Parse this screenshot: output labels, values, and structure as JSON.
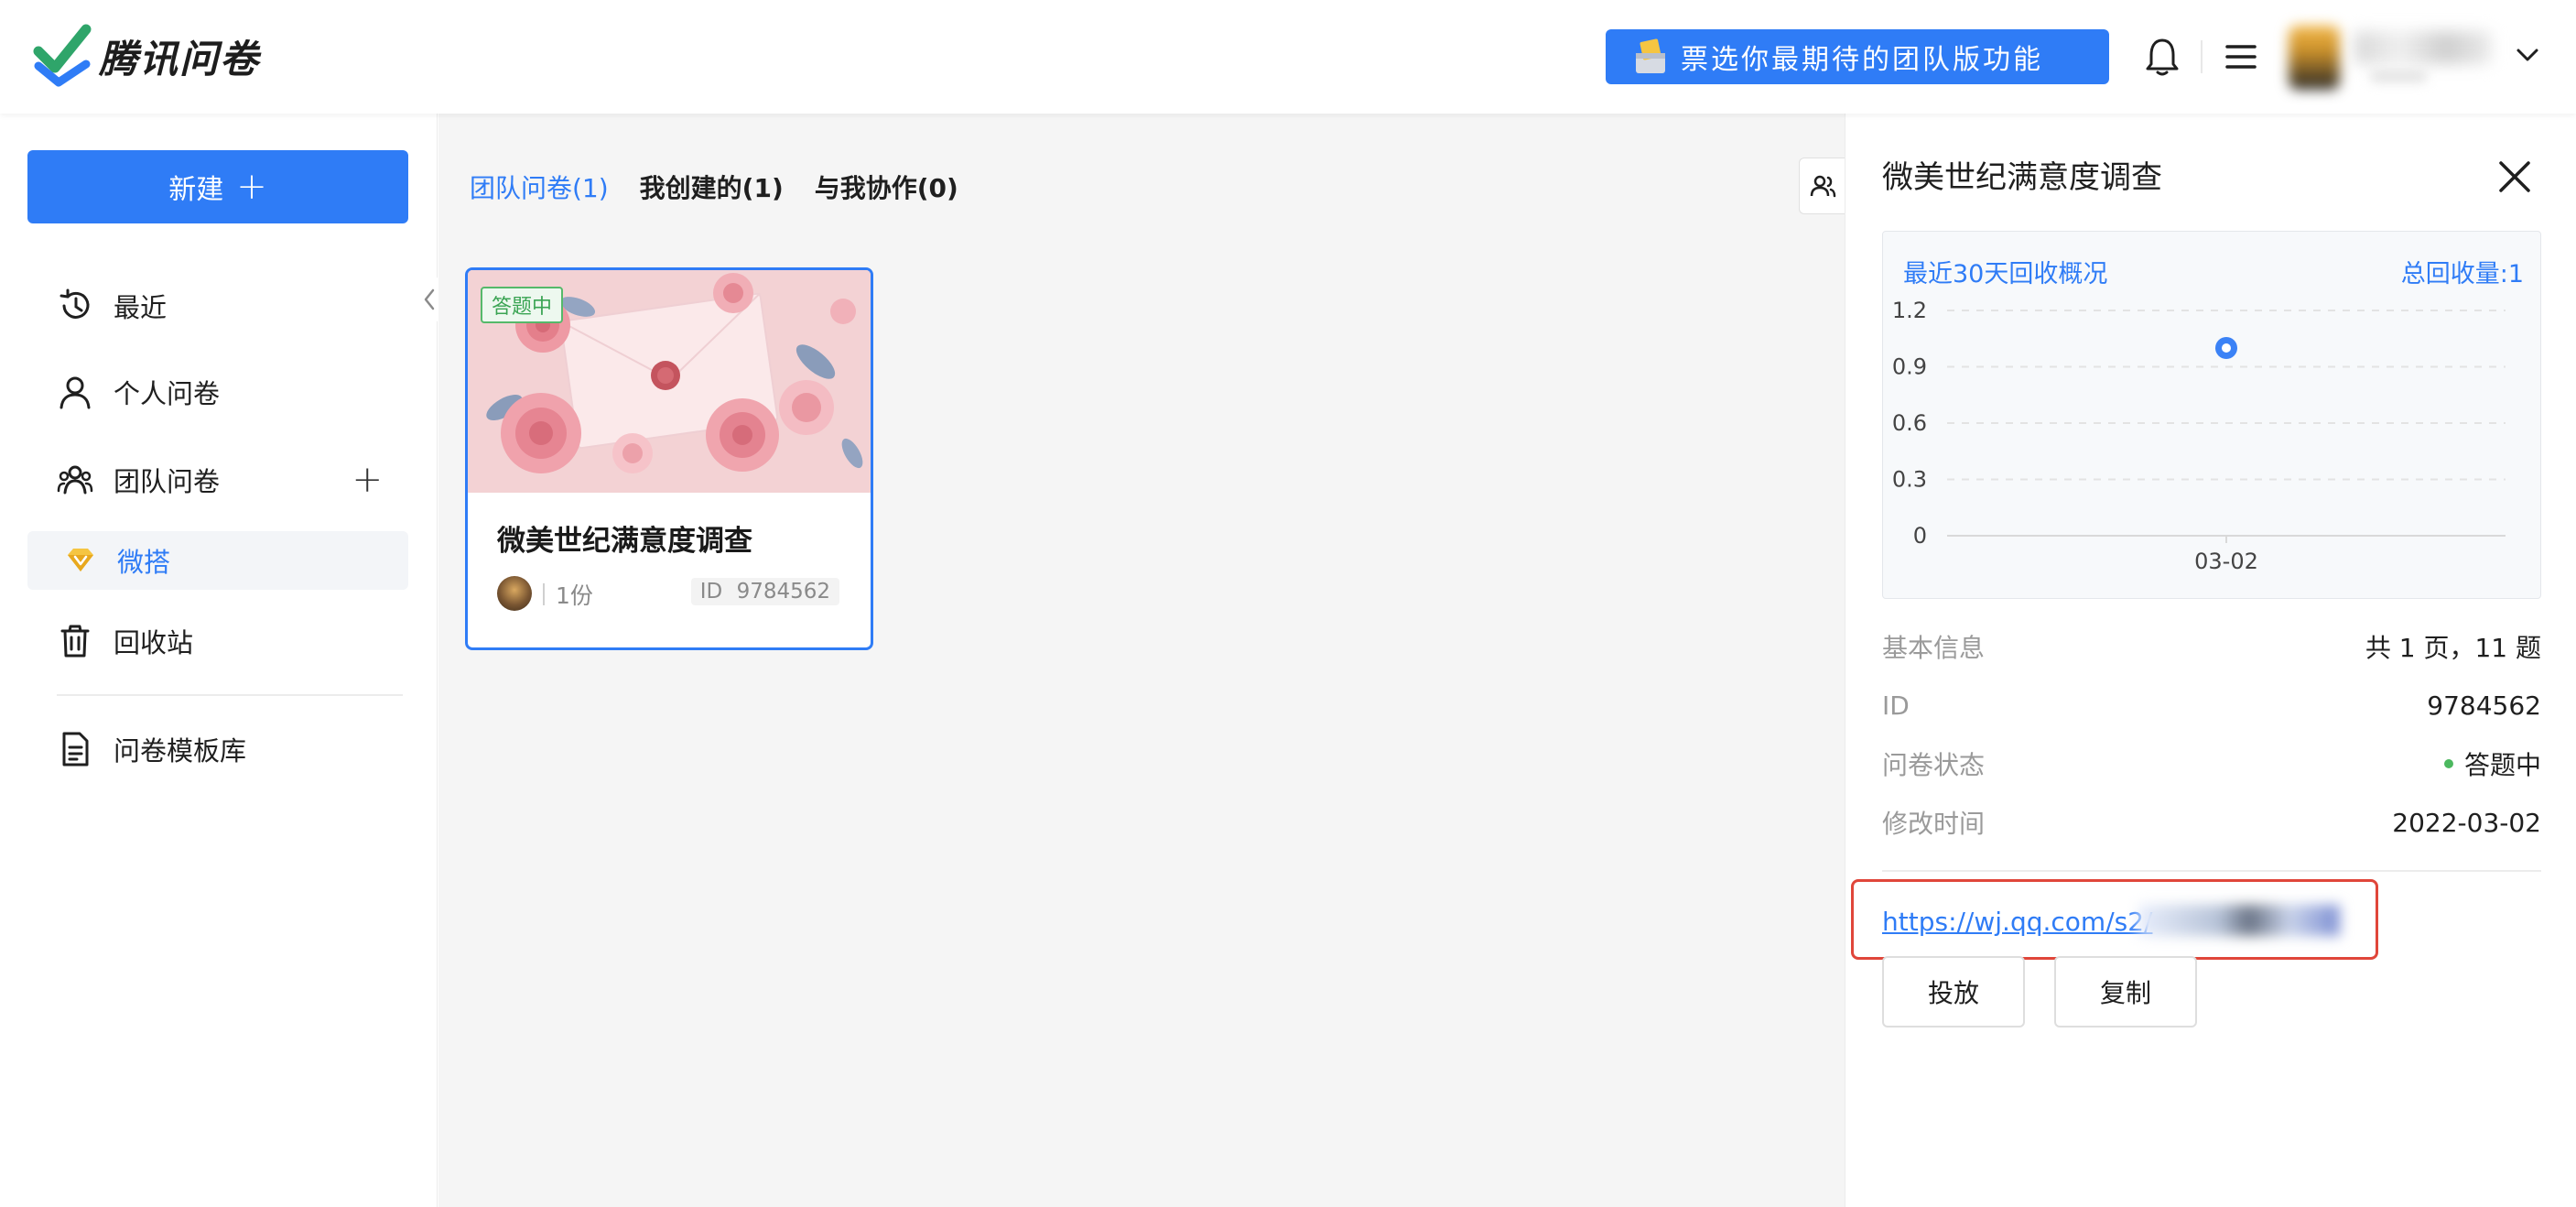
{
  "app": {
    "logo_text": "腾讯问卷",
    "promo_label": "票选你最期待的团队版功能"
  },
  "sidebar": {
    "new_label": "新建",
    "items": [
      {
        "label": "最近",
        "icon": "history-icon"
      },
      {
        "label": "个人问卷",
        "icon": "user-icon"
      },
      {
        "label": "团队问卷",
        "icon": "team-icon"
      },
      {
        "label": "微搭",
        "icon": "gem-icon"
      },
      {
        "label": "回收站",
        "icon": "trash-icon"
      },
      {
        "label": "问卷模板库",
        "icon": "template-icon"
      }
    ]
  },
  "main": {
    "tabs": [
      {
        "label": "团队问卷(1)",
        "active": true
      },
      {
        "label": "我创建的(1)",
        "active": false
      },
      {
        "label": "与我协作(0)",
        "active": false
      }
    ],
    "card": {
      "status": "答题中",
      "title": "微美世纪满意度调查",
      "count": "1份",
      "id_label": "ID",
      "id_value": "9784562"
    }
  },
  "panel": {
    "title": "微美世纪满意度调查",
    "chart_head_left": "最近30天回收概况",
    "chart_head_right": "总回收量:1",
    "info": [
      {
        "key": "基本信息",
        "value": "共 1 页，11 题"
      },
      {
        "key": "ID",
        "value": "9784562"
      },
      {
        "key": "问卷状态",
        "value": "答题中"
      },
      {
        "key": "修改时间",
        "value": "2022-03-02"
      }
    ],
    "link_text": "https://wj.qq.com/s2/",
    "deliver_label": "投放",
    "copy_label": "复制"
  },
  "colors": {
    "accent": "#2f7cf6",
    "status_green": "#4cb85f",
    "highlight_red": "#e0463a"
  },
  "chart_data": {
    "type": "line",
    "title": "最近30天回收概况",
    "x": [
      "03-02"
    ],
    "series": [
      {
        "values": [
          1
        ]
      }
    ],
    "yticks": [
      "1.2",
      "0.9",
      "0.6",
      "0.3",
      "0"
    ],
    "ylim": [
      0,
      1.2
    ],
    "grid": true
  }
}
